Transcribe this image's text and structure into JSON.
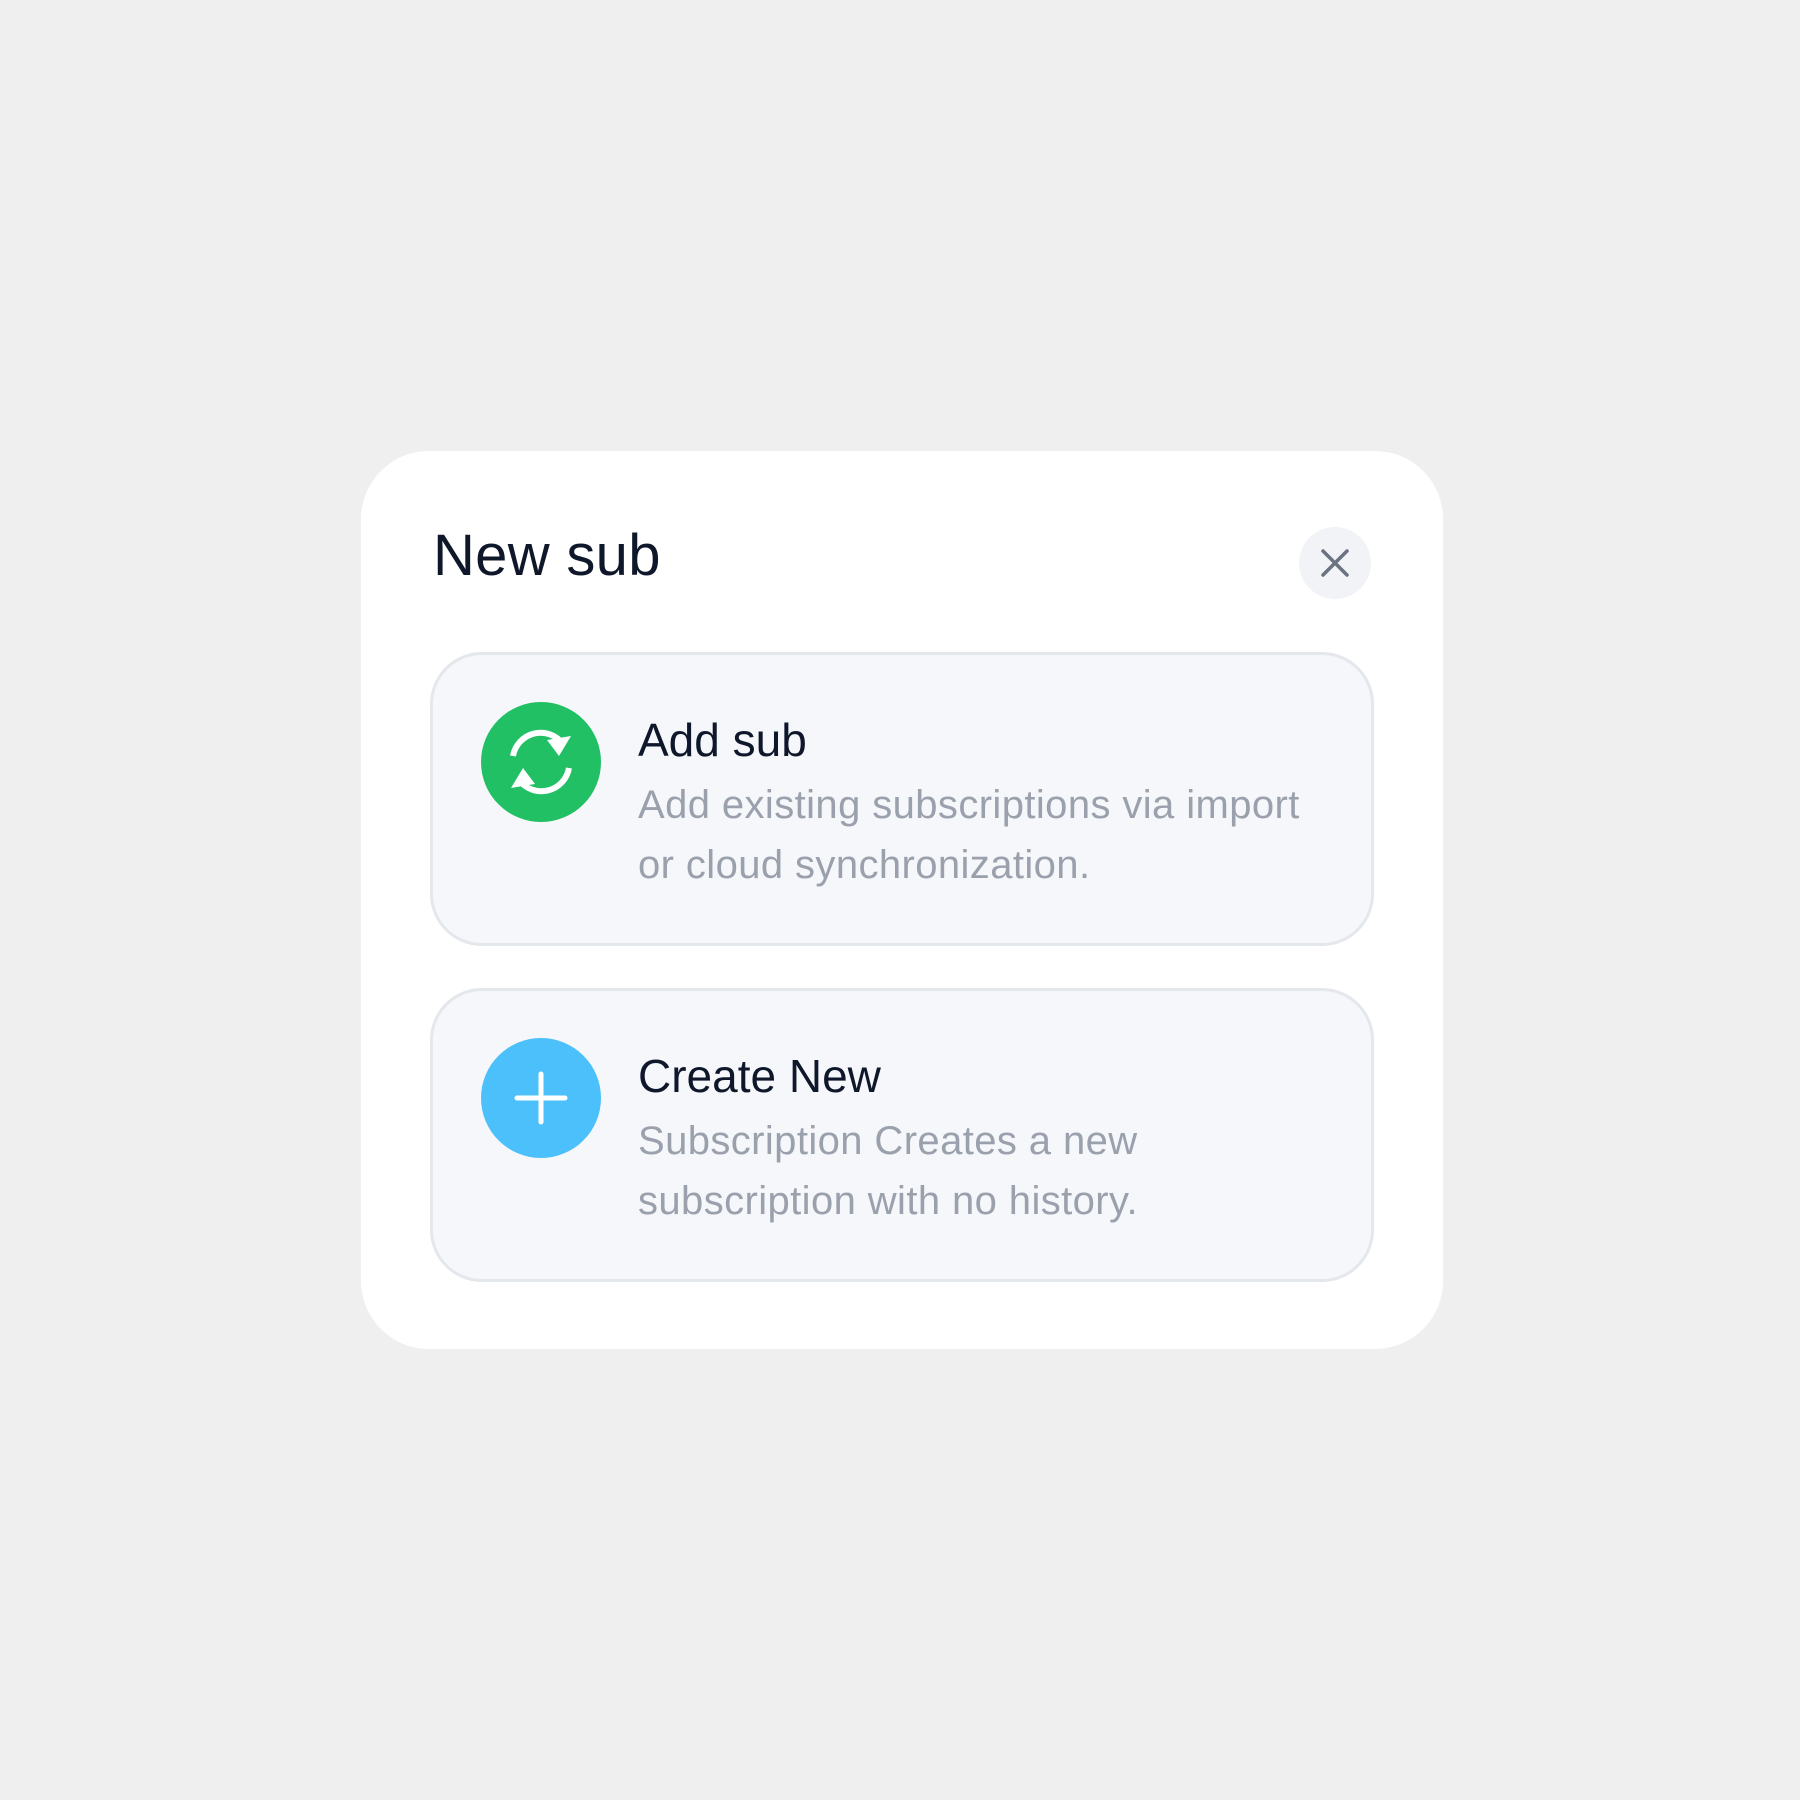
{
  "dialog": {
    "title": "New sub",
    "close_icon": "close-icon"
  },
  "options": [
    {
      "title": "Add sub",
      "description": "Add existing subscriptions via import or cloud synchronization.",
      "icon": "sync-icon",
      "icon_color": "#22c065"
    },
    {
      "title": "Create New",
      "description": "Subscription Creates a new subscription with no history.",
      "icon": "plus-icon",
      "icon_color": "#4cc0fb"
    }
  ],
  "colors": {
    "background": "#efefef",
    "dialog": "#ffffff",
    "card": "#f5f7fa",
    "card_border": "#e4e7ec",
    "title_text": "#0f172a",
    "muted_text": "#9aa1ad"
  }
}
